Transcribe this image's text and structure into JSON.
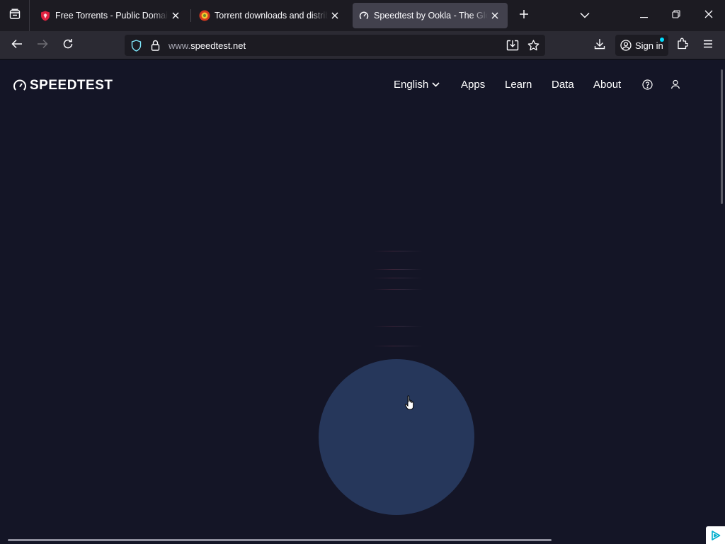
{
  "browser": {
    "tabs": [
      {
        "title": "Free Torrents - Public Domain, Creative Commons",
        "favicon": "shield-favicon",
        "active": false
      },
      {
        "title": "Torrent downloads and distribution",
        "favicon": "flower-favicon",
        "active": false
      },
      {
        "title": "Speedtest by Ookla - The Global Broadband Speed Test",
        "favicon": "gauge-favicon",
        "active": true
      }
    ],
    "url": {
      "prefix": "www.",
      "domain": "speedtest.net"
    },
    "signin_label": "Sign in",
    "colors": {
      "active_tab": "#42414d",
      "toolbar": "#2b2a33",
      "tabstrip": "#1c1b22",
      "accent_dot": "#00ddff"
    }
  },
  "site": {
    "logo_text": "SPEEDTEST",
    "nav": {
      "language": "English",
      "apps": "Apps",
      "learn": "Learn",
      "data": "Data",
      "about": "About"
    },
    "colors": {
      "background": "#141526",
      "go_button": "#26375b"
    }
  },
  "icons": [
    "firefox-view-icon",
    "close-icon",
    "plus-icon",
    "chevron-down-icon",
    "minimize-icon",
    "restore-icon",
    "back-icon",
    "forward-icon",
    "reload-icon",
    "shield-icon",
    "lock-icon",
    "install-app-icon",
    "star-icon",
    "download-icon",
    "account-icon",
    "extensions-icon",
    "menu-icon",
    "help-icon",
    "user-icon",
    "adchoices-icon"
  ]
}
